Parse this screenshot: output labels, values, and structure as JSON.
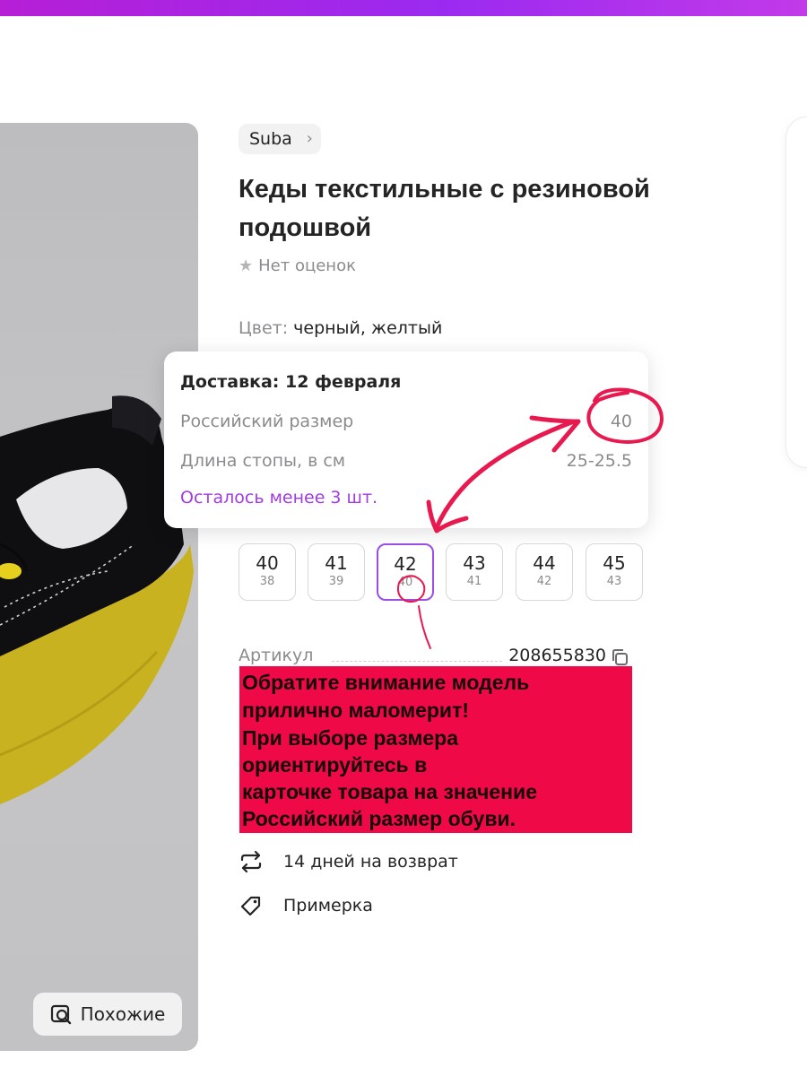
{
  "colors": {
    "accent": "#9b4ee6",
    "stock_text": "#a13ce0",
    "annotation_red": "#e8194f",
    "notice_bg": "#ef0a47"
  },
  "gallery": {
    "similar_button": "Похожие",
    "similar_icon": "search-image-icon"
  },
  "product": {
    "brand": "Suba",
    "title_line1": "Кеды текстильные с резиновой",
    "title_line2": "подошвой",
    "rating_text": "Нет оценок",
    "color_label": "Цвет:",
    "color_value": "черный, желтый"
  },
  "tooltip": {
    "delivery": "Доставка: 12 февраля",
    "ru_size_label": "Российский размер",
    "ru_size_value": "40",
    "foot_length_label": "Длина стопы, в см",
    "foot_length_value": "25-25.5",
    "stock_note": "Осталось менее 3 шт."
  },
  "sizes": [
    {
      "size": "40",
      "ru": "38",
      "selected": false
    },
    {
      "size": "41",
      "ru": "39",
      "selected": false
    },
    {
      "size": "42",
      "ru": "40",
      "selected": true
    },
    {
      "size": "43",
      "ru": "41",
      "selected": false
    },
    {
      "size": "44",
      "ru": "42",
      "selected": false
    },
    {
      "size": "45",
      "ru": "43",
      "selected": false
    }
  ],
  "article": {
    "label": "Артикул",
    "number": "208655830"
  },
  "notice_lines": [
    "Обратите внимание модель",
    "прилично маломерит!",
    "При выборе размера",
    "ориентируйтесь в",
    "карточке товара на значение",
    "Российский размер обуви."
  ],
  "features": {
    "returns": "14 дней на возврат",
    "fitting": "Примерка"
  }
}
